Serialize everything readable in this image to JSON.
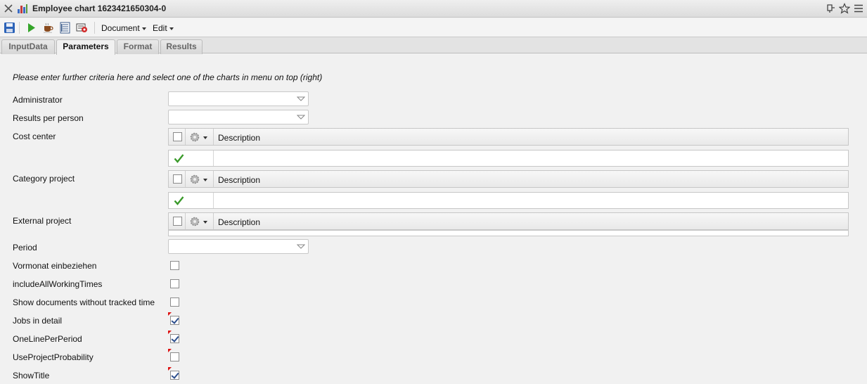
{
  "window": {
    "title": "Employee chart 1623421650304-0"
  },
  "toolbar": {
    "menus": [
      "Document",
      "Edit"
    ]
  },
  "tabs": [
    "InputData",
    "Parameters",
    "Format",
    "Results"
  ],
  "active_tab": "Parameters",
  "form": {
    "intro": "Please enter further criteria here and select one of the charts in menu on top (right)",
    "administrator_label": "Administrator",
    "results_per_person_label": "Results per person",
    "cost_center_label": "Cost center",
    "category_project_label": "Category project",
    "external_project_label": "External project",
    "grid_column_description": "Description",
    "period_label": "Period",
    "vormonat_label": "Vormonat einbeziehen",
    "include_all_label": "includeAllWorkingTimes",
    "show_docs_label": "Show documents without tracked time",
    "jobs_detail_label": "Jobs in detail",
    "one_line_label": "OneLinePerPeriod",
    "use_prob_label": "UseProjectProbability",
    "show_title_label": "ShowTitle"
  },
  "checkboxes": {
    "vormonat": false,
    "include_all": false,
    "show_docs": false,
    "jobs_detail": true,
    "one_line": true,
    "use_prob": false,
    "show_title": true
  },
  "colors": {
    "accent_blue": "#2d4f8d",
    "check_green": "#3a9a2a",
    "dirty_marker": "#d11111"
  }
}
